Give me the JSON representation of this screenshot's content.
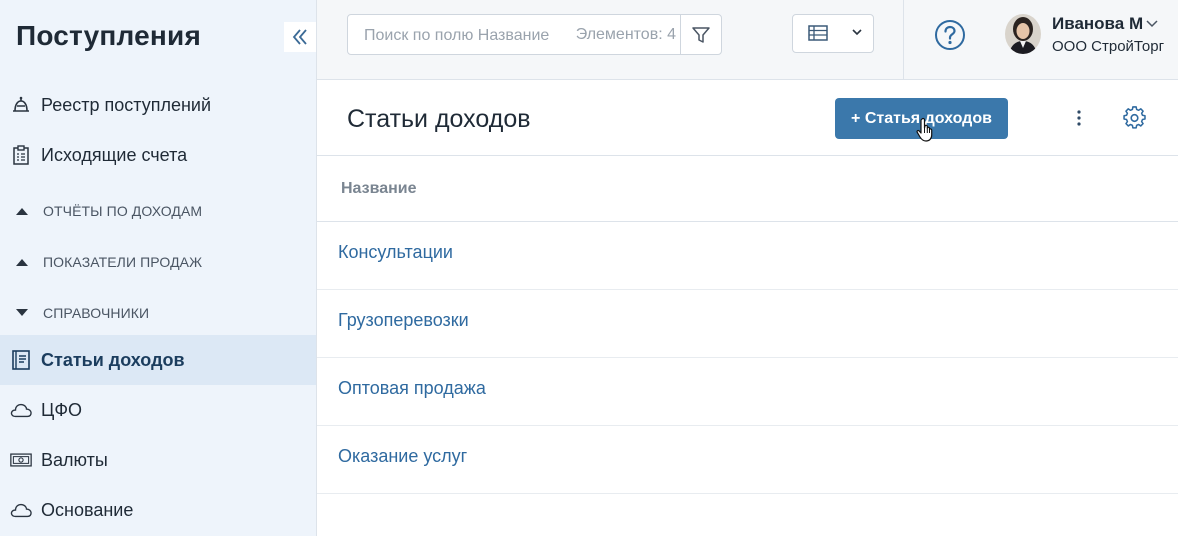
{
  "sidebar": {
    "title": "Поступления",
    "items": [
      {
        "label": "Реестр поступлений",
        "icon": "bell-icon"
      },
      {
        "label": "Исходящие счета",
        "icon": "clipboard-icon"
      },
      {
        "label": "ОТЧЁТЫ ПО ДОХОДАМ",
        "icon": "triangle-up-icon"
      },
      {
        "label": "ПОКАЗАТЕЛИ ПРОДАЖ",
        "icon": "triangle-up-icon"
      },
      {
        "label": "СПРАВОЧНИКИ",
        "icon": "triangle-down-icon"
      },
      {
        "label": "Статьи доходов",
        "icon": "book-icon"
      },
      {
        "label": "ЦФО",
        "icon": "cloud-icon"
      },
      {
        "label": "Валюты",
        "icon": "banknote-icon"
      },
      {
        "label": "Основание",
        "icon": "cloud-icon"
      }
    ]
  },
  "topbar": {
    "search_placeholder": "Поиск по полю Название",
    "elements_count": "Элементов: 4",
    "user_name": "Иванова М",
    "user_org": "ООО СтройТорг"
  },
  "main": {
    "title": "Статьи доходов",
    "add_button": "+ Статья доходов",
    "column_header": "Название",
    "rows": [
      "Консультации",
      "Грузоперевозки",
      "Оптовая продажа",
      "Оказание услуг"
    ]
  },
  "colors": {
    "accent": "#3b78ab",
    "link": "#2f6aa0",
    "sidebar_bg": "#eef4fb",
    "sidebar_active_bg": "#dce8f5"
  }
}
